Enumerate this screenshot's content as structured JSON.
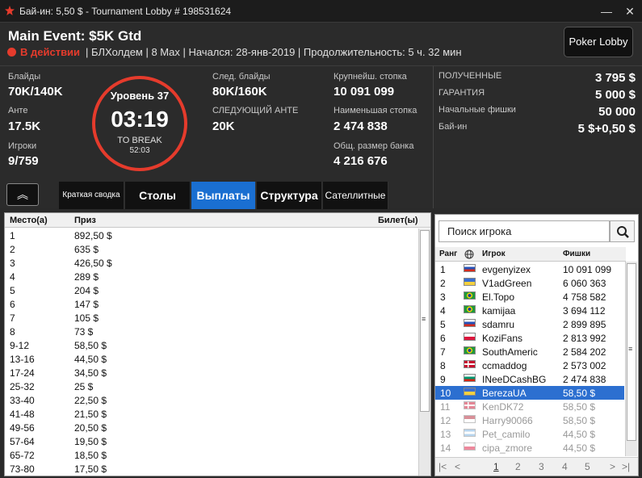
{
  "window": {
    "title": "Бай-ин: 5,50 $ - Tournament Lobby # 198531624",
    "minimize_glyph": "—",
    "close_glyph": "✕"
  },
  "header": {
    "event_name": "Main Event: $5K Gtd",
    "status": "В действии",
    "info": "| БЛХолдем | 8 Max | Начался: 28-янв-2019 | Продолжительность: 5 ч. 32 мин",
    "lobby_button": "Poker Lobby"
  },
  "stats": {
    "blinds_label": "Блайды",
    "blinds_value": "70K/140K",
    "ante_label": "Анте",
    "ante_value": "17.5K",
    "players_label": "Игроки",
    "players_value": "9/759",
    "next_blinds_label": "След. блайды",
    "next_blinds_value": "80K/160K",
    "next_ante_label": "СЛЕДУЮЩИЙ АНТЕ",
    "next_ante_value": "20K",
    "largest_label": "Крупнейш. стопка",
    "largest_value": "10 091 099",
    "smallest_label": "Наименьшая стопка",
    "smallest_value": "2 474 838",
    "pot_label": "Общ. размер банка",
    "pot_value": "4 216 676"
  },
  "clock": {
    "level": "Уровень 37",
    "time": "03:19",
    "to_break_label": "TO BREAK",
    "to_break_time": "52:03"
  },
  "prize": {
    "received_label": "ПОЛУЧЕННЫЕ",
    "received_value": "3 795 $",
    "guarantee_label": "ГАРАНТИЯ",
    "guarantee_value": "5 000 $",
    "starting_label": "Начальные фишки",
    "starting_value": "50 000",
    "buyin_label": "Бай-ин",
    "buyin_value": "5 $+0,50 $"
  },
  "tabs": {
    "collapse_glyph": "︽",
    "summary": "Краткая сводка",
    "tables": "Столы",
    "payouts": "Выплаты",
    "structure": "Структура",
    "satellites": "Сателлитные"
  },
  "payouts": {
    "headers": {
      "place": "Место(а)",
      "prize": "Приз",
      "ticket": "Билет(ы)"
    },
    "rows": [
      {
        "place": "1",
        "prize": "892,50 $"
      },
      {
        "place": "2",
        "prize": "635 $"
      },
      {
        "place": "3",
        "prize": "426,50 $"
      },
      {
        "place": "4",
        "prize": "289 $"
      },
      {
        "place": "5",
        "prize": "204 $"
      },
      {
        "place": "6",
        "prize": "147 $"
      },
      {
        "place": "7",
        "prize": "105 $"
      },
      {
        "place": "8",
        "prize": "73 $"
      },
      {
        "place": "9-12",
        "prize": "58,50 $"
      },
      {
        "place": "13-16",
        "prize": "44,50 $"
      },
      {
        "place": "17-24",
        "prize": "34,50 $"
      },
      {
        "place": "25-32",
        "prize": "25 $"
      },
      {
        "place": "33-40",
        "prize": "22,50 $"
      },
      {
        "place": "41-48",
        "prize": "21,50 $"
      },
      {
        "place": "49-56",
        "prize": "20,50 $"
      },
      {
        "place": "57-64",
        "prize": "19,50 $"
      },
      {
        "place": "65-72",
        "prize": "18,50 $"
      },
      {
        "place": "73-80",
        "prize": "17,50 $"
      }
    ]
  },
  "players": {
    "search_placeholder": "Поиск игрока",
    "headers": {
      "rank": "Ранг",
      "player": "Игрок",
      "chips": "Фишки"
    },
    "rows": [
      {
        "rank": "1",
        "name": "evgenyizex",
        "chips": "10 091 099",
        "flag": "ru"
      },
      {
        "rank": "2",
        "name": "V1adGreen",
        "chips": "6 060 363",
        "flag": "ua"
      },
      {
        "rank": "3",
        "name": "El.Topo",
        "chips": "4 758 582",
        "flag": "br"
      },
      {
        "rank": "4",
        "name": "kamijaa",
        "chips": "3 694 112",
        "flag": "br"
      },
      {
        "rank": "5",
        "name": "sdamru",
        "chips": "2 899 895",
        "flag": "ru"
      },
      {
        "rank": "6",
        "name": "KoziFans",
        "chips": "2 813 992",
        "flag": "pl"
      },
      {
        "rank": "7",
        "name": "SouthAmeric",
        "chips": "2 584 202",
        "flag": "br"
      },
      {
        "rank": "8",
        "name": "ccmaddog",
        "chips": "2 573 002",
        "flag": "dk"
      },
      {
        "rank": "9",
        "name": "INeeDCashBG",
        "chips": "2 474 838",
        "flag": "bg"
      },
      {
        "rank": "10",
        "name": "BerezaUA",
        "chips": "58,50 $",
        "flag": "ua"
      },
      {
        "rank": "11",
        "name": "KenDK72",
        "chips": "58,50 $",
        "flag": "dk"
      },
      {
        "rank": "12",
        "name": "Harry90066",
        "chips": "58,50 $",
        "flag": "us"
      },
      {
        "rank": "13",
        "name": "Pet_camilo",
        "chips": "44,50 $",
        "flag": "ar"
      },
      {
        "rank": "14",
        "name": "cipa_zmore",
        "chips": "44,50 $",
        "flag": "pl"
      }
    ],
    "pages": [
      "1",
      "2",
      "3",
      "4",
      "5"
    ]
  },
  "colors": {
    "accent": "#1a6fd1",
    "live": "#e53b2c"
  }
}
